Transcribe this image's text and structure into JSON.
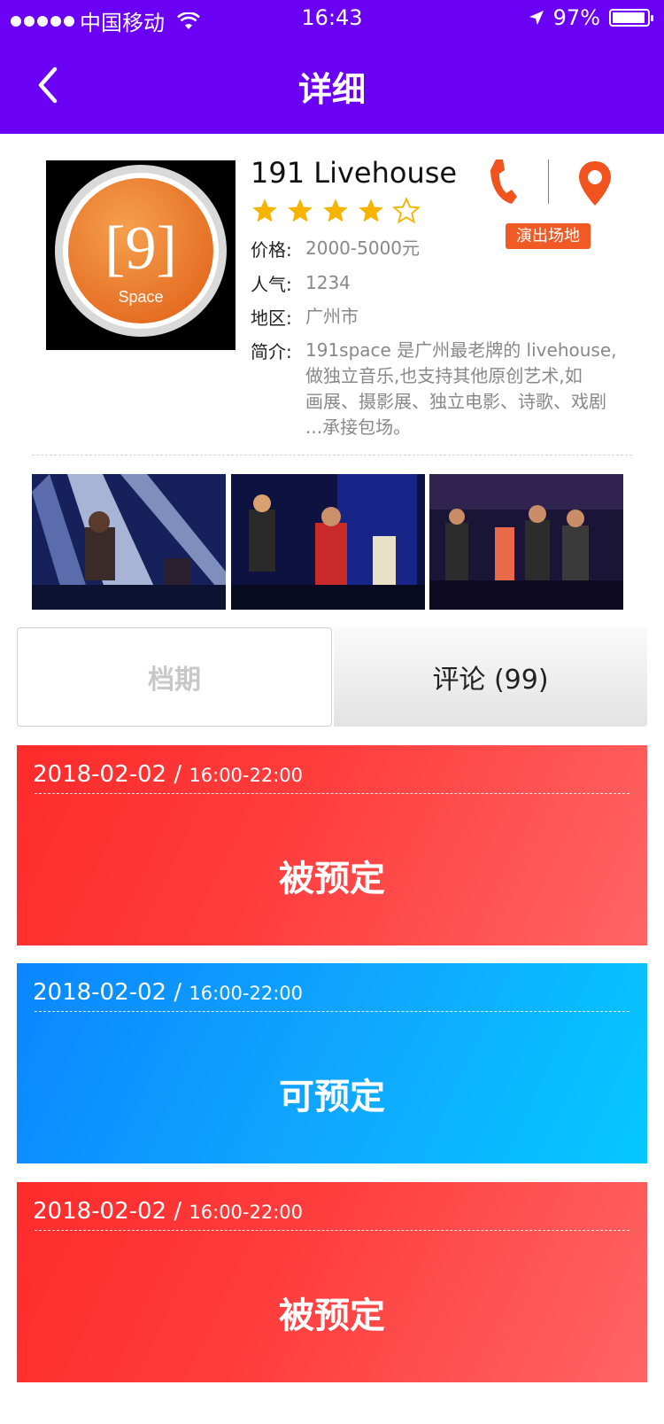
{
  "status_bar": {
    "carrier": "中国移动",
    "time": "16:43",
    "battery": "97%"
  },
  "nav": {
    "title": "详细"
  },
  "venue": {
    "name": "191 Livehouse",
    "rating": 4,
    "rating_max": 5,
    "price_label": "价格:",
    "price": "2000-5000元",
    "popularity_label": "人气:",
    "popularity": "1234",
    "region_label": "地区:",
    "region": "广州市",
    "intro_label": "简介:",
    "intro_lines": [
      "191space 是广州最老牌的 livehouse,",
      "做独立音乐,也支持其他原创艺术,如",
      "画展、摄影展、独立电影、诗歌、戏剧",
      "...承接包场。"
    ],
    "tag": "演出场地",
    "logo_text": "[9]",
    "logo_sub": "Space"
  },
  "tabs": {
    "schedule": "档期",
    "comments": "评论 (99)"
  },
  "slots": [
    {
      "date": "2018-02-02 / ",
      "time": "16:00-22:00",
      "status": "被预定",
      "color": "#ff3b3b"
    },
    {
      "date": "2018-02-02 / ",
      "time": "16:00-22:00",
      "status": "可预定",
      "color": "#10a6ff"
    },
    {
      "date": "2018-02-02 / ",
      "time": "16:00-22:00",
      "status": "被预定",
      "color": "#ff3b3b"
    }
  ],
  "colors": {
    "nav": "#6a00f4",
    "accent": "#f15a24",
    "star": "#f5b400"
  },
  "icons": [
    "back-icon",
    "phone-icon",
    "location-pin-icon",
    "star-icon",
    "wifi-icon",
    "location-arrow-icon",
    "battery-icon"
  ]
}
